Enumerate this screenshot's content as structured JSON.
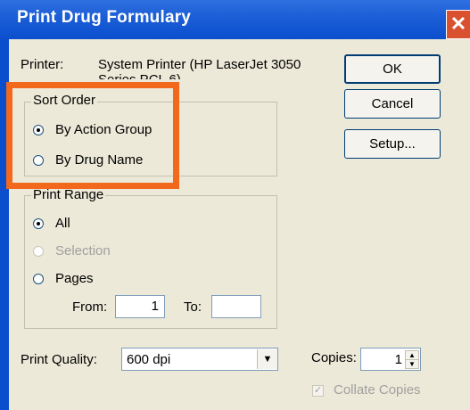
{
  "window": {
    "title": "Print Drug Formulary",
    "close_glyph": "✕"
  },
  "printer": {
    "label": "Printer:",
    "value_line1": "System Printer (HP LaserJet 3050",
    "value_line2": "Series PCL 6)"
  },
  "buttons": {
    "ok": "OK",
    "cancel": "Cancel",
    "setup": "Setup..."
  },
  "sort_order": {
    "title": "Sort Order",
    "options": [
      {
        "label": "By Action Group",
        "selected": true
      },
      {
        "label": "By Drug Name",
        "selected": false
      }
    ]
  },
  "print_range": {
    "title": "Print Range",
    "options": [
      {
        "label": "All",
        "selected": true,
        "enabled": true
      },
      {
        "label": "Selection",
        "selected": false,
        "enabled": false
      },
      {
        "label": "Pages",
        "selected": false,
        "enabled": true
      }
    ],
    "from_label": "From:",
    "from_value": "1",
    "to_label": "To:",
    "to_value": ""
  },
  "print_quality": {
    "label": "Print Quality:",
    "value": "600 dpi"
  },
  "copies": {
    "label": "Copies:",
    "value": "1"
  },
  "collate": {
    "label": "Collate Copies",
    "checked": true,
    "enabled": false
  },
  "colors": {
    "highlight": "#f2691d",
    "titlebar": "#0b4fcf",
    "dialog_bg": "#ece9d8"
  },
  "icons": {
    "close": "close-icon",
    "dropdown": "chevron-down-icon",
    "spin_up": "spin-up-icon",
    "spin_down": "spin-down-icon",
    "check": "checkmark-icon"
  }
}
